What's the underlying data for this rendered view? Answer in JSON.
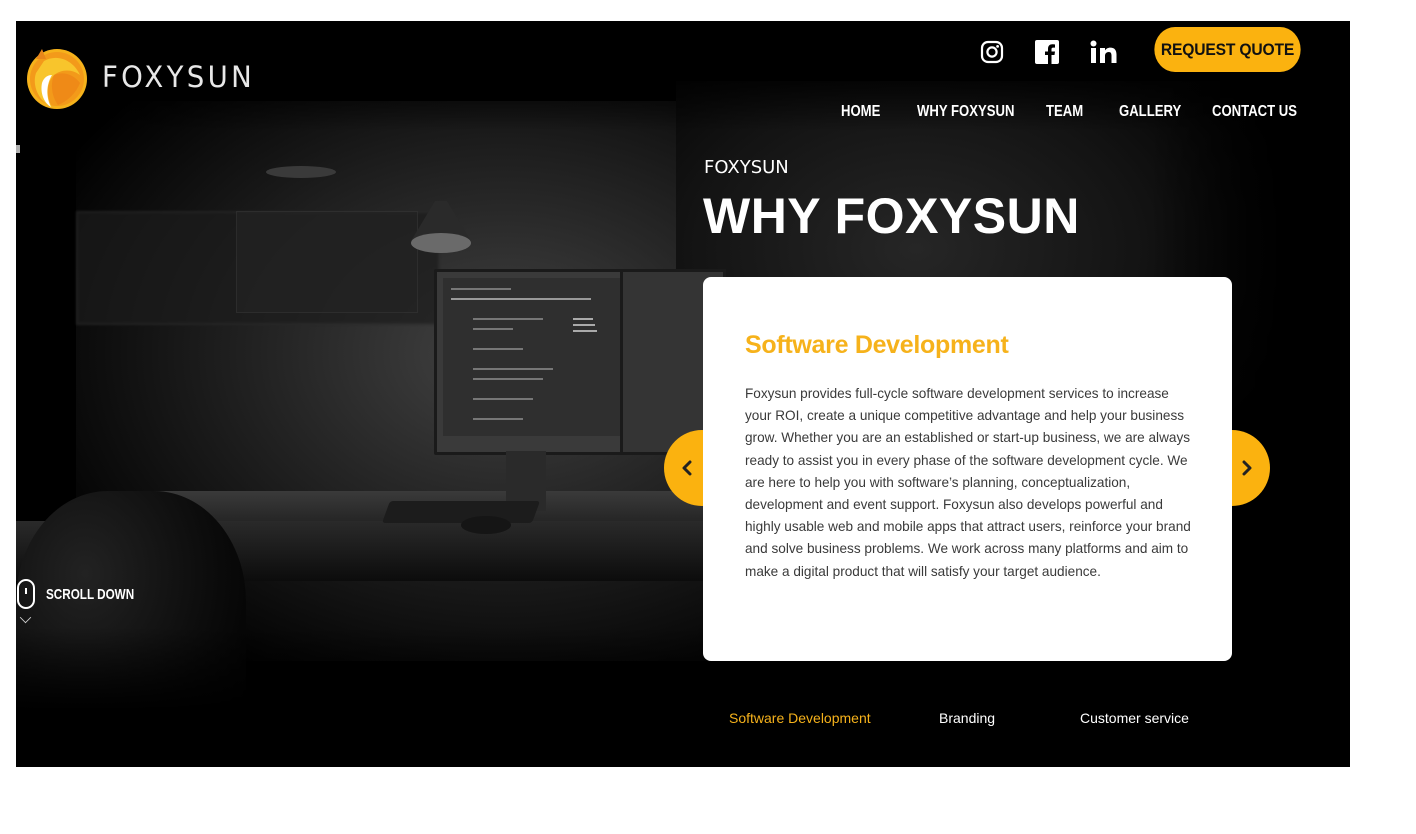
{
  "brand": {
    "name": "FOXYSUN",
    "logo_icon": "fox-sun-logo-icon",
    "colors": {
      "accent": "#fbb20f",
      "accent_text": "#f6b21b",
      "background": "#000000",
      "card": "#ffffff"
    }
  },
  "header": {
    "social": [
      {
        "name": "instagram",
        "icon": "instagram-icon"
      },
      {
        "name": "facebook",
        "icon": "facebook-icon"
      },
      {
        "name": "linkedin",
        "icon": "linkedin-icon"
      }
    ],
    "cta_label": "REQUEST QUOTE",
    "nav": [
      "HOME",
      "WHY FOXYSUN",
      "TEAM",
      "GALLERY",
      "CONTACT US"
    ]
  },
  "hero": {
    "eyebrow": "FOXYSUN",
    "title": "WHY FOXYSUN",
    "scroll_label": "SCROLL DOWN"
  },
  "slider": {
    "prev_icon": "chevron-left-icon",
    "next_icon": "chevron-right-icon",
    "card": {
      "title": "Software Development",
      "body": "Foxysun provides full-cycle software development services to increase your ROI, create a unique competitive advantage and help your business grow. Whether you are an established or start-up business, we are always ready to assist you in every phase of the software development cycle. We are here to help you with software’s planning, conceptualization, development and event support. Foxysun also develops powerful and highly usable web and mobile apps that attract users, reinforce your brand and solve business problems. We work across many platforms and aim to make a digital product that will satisfy your target audience."
    },
    "tabs": [
      {
        "label": "Software Development",
        "active": true
      },
      {
        "label": "Branding",
        "active": false
      },
      {
        "label": "Customer service",
        "active": false
      }
    ]
  }
}
